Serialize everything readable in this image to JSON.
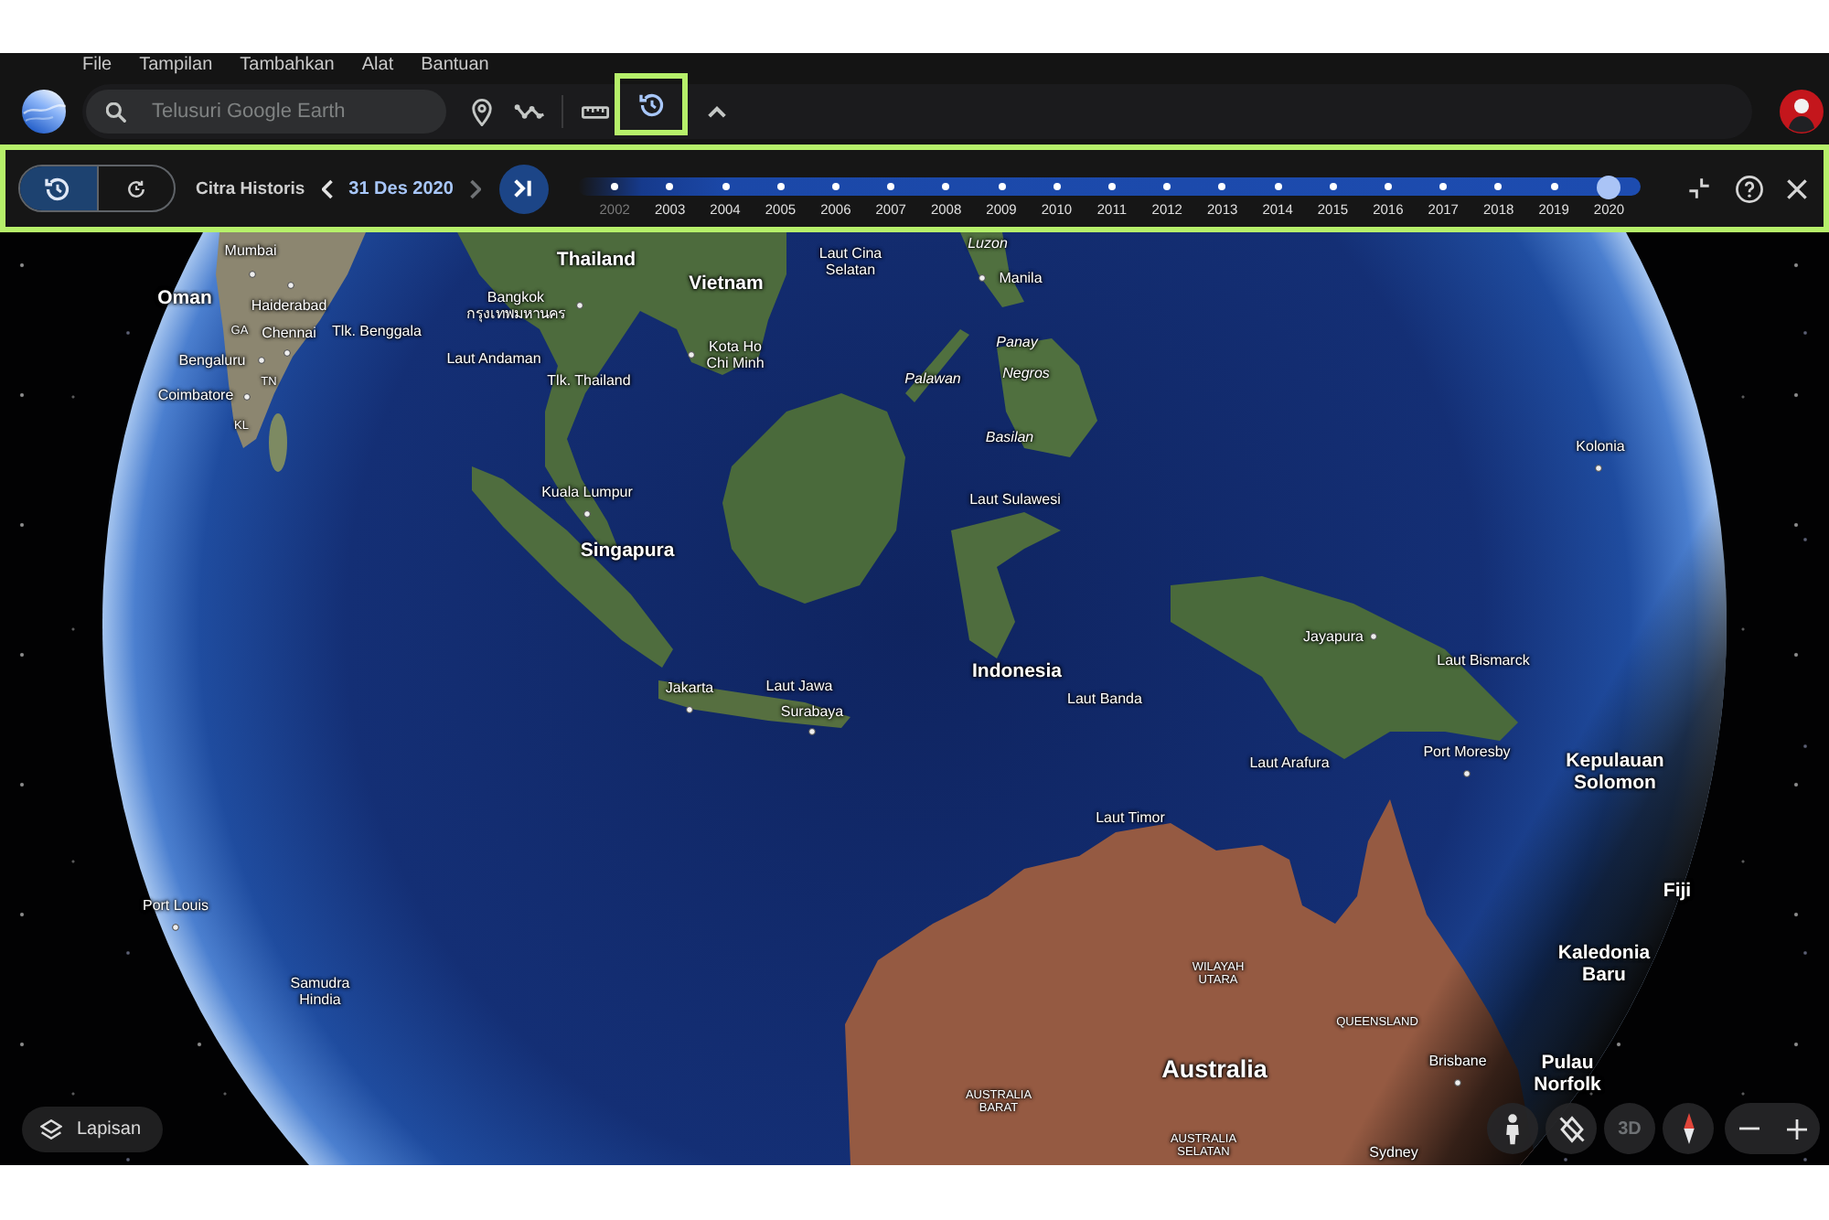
{
  "menu_bar": {
    "items": [
      "File",
      "Tampilan",
      "Tambahkan",
      "Alat",
      "Bantuan"
    ]
  },
  "toolbar": {
    "search": {
      "placeholder": "Telusuri Google Earth"
    },
    "tools": [
      {
        "kind": "placemark",
        "highlighted": false
      },
      {
        "kind": "path",
        "highlighted": false
      },
      {
        "kind": "divider"
      },
      {
        "kind": "ruler",
        "highlighted": false
      },
      {
        "kind": "history",
        "highlighted": true
      },
      {
        "kind": "toggle_toolbar",
        "highlighted": false
      }
    ]
  },
  "history_bar": {
    "highlighted": true,
    "modes": [
      {
        "kind": "history",
        "selected": true
      },
      {
        "kind": "timelapse",
        "selected": false
      }
    ],
    "title": "Citra Historis",
    "previous": {
      "disabled": false
    },
    "date": "31 Des 2020",
    "next": {
      "disabled": true
    },
    "years": [
      {
        "label": "2002",
        "selected": false,
        "dimmed": true
      },
      {
        "label": "2003",
        "selected": false,
        "dimmed": false
      },
      {
        "label": "2004",
        "selected": false,
        "dimmed": false
      },
      {
        "label": "2005",
        "selected": false,
        "dimmed": false
      },
      {
        "label": "2006",
        "selected": false,
        "dimmed": false
      },
      {
        "label": "2007",
        "selected": false,
        "dimmed": false
      },
      {
        "label": "2008",
        "selected": false,
        "dimmed": false
      },
      {
        "label": "2009",
        "selected": false,
        "dimmed": false
      },
      {
        "label": "2010",
        "selected": false,
        "dimmed": false
      },
      {
        "label": "2011",
        "selected": false,
        "dimmed": false
      },
      {
        "label": "2012",
        "selected": false,
        "dimmed": false
      },
      {
        "label": "2013",
        "selected": false,
        "dimmed": false
      },
      {
        "label": "2014",
        "selected": false,
        "dimmed": false
      },
      {
        "label": "2015",
        "selected": false,
        "dimmed": false
      },
      {
        "label": "2016",
        "selected": false,
        "dimmed": false
      },
      {
        "label": "2017",
        "selected": false,
        "dimmed": false
      },
      {
        "label": "2018",
        "selected": false,
        "dimmed": false
      },
      {
        "label": "2019",
        "selected": false,
        "dimmed": false
      },
      {
        "label": "2020",
        "selected": true,
        "dimmed": false
      }
    ],
    "actions": [
      {
        "kind": "collapse"
      },
      {
        "kind": "help"
      },
      {
        "kind": "close"
      }
    ]
  },
  "map": {
    "labels": [
      {
        "text": "Mumbai",
        "kind": "place"
      },
      {
        "text": "Oman",
        "kind": "country"
      },
      {
        "text": "Haiderabad",
        "kind": "place"
      },
      {
        "text": "GA",
        "kind": "region"
      },
      {
        "text": "Chennai",
        "kind": "place"
      },
      {
        "text": "Tlk. Benggala",
        "kind": "place"
      },
      {
        "text": "Bengaluru",
        "kind": "place"
      },
      {
        "text": "TN",
        "kind": "region"
      },
      {
        "text": "Coimbatore",
        "kind": "place"
      },
      {
        "text": "KL",
        "kind": "region"
      },
      {
        "text": "Thailand",
        "kind": "country"
      },
      {
        "text": "Vietnam",
        "kind": "country"
      },
      {
        "text": "Laut Cina\nSelatan",
        "kind": "place"
      },
      {
        "text": "Bangkok\nกรุงเทพมหานคร",
        "kind": "place"
      },
      {
        "text": "Laut Andaman",
        "kind": "place"
      },
      {
        "text": "Kota Ho\nChi Minh",
        "kind": "place"
      },
      {
        "text": "Tlk. Thailand",
        "kind": "place"
      },
      {
        "text": "Kuala Lumpur",
        "kind": "place"
      },
      {
        "text": "Singapura",
        "kind": "country"
      },
      {
        "text": "Jakarta",
        "kind": "place"
      },
      {
        "text": "Laut Jawa",
        "kind": "place"
      },
      {
        "text": "Surabaya",
        "kind": "place"
      },
      {
        "text": "Luzon",
        "kind": "island"
      },
      {
        "text": "Manila",
        "kind": "place"
      },
      {
        "text": "Panay",
        "kind": "island"
      },
      {
        "text": "Palawan",
        "kind": "island"
      },
      {
        "text": "Negros",
        "kind": "island"
      },
      {
        "text": "Basilan",
        "kind": "island"
      },
      {
        "text": "Laut Sulawesi",
        "kind": "place"
      },
      {
        "text": "Kolonia",
        "kind": "place"
      },
      {
        "text": "Jayapura",
        "kind": "place"
      },
      {
        "text": "Indonesia",
        "kind": "country"
      },
      {
        "text": "Laut Bismarck",
        "kind": "place"
      },
      {
        "text": "Laut Banda",
        "kind": "place"
      },
      {
        "text": "Laut Arafura",
        "kind": "place"
      },
      {
        "text": "Port Moresby",
        "kind": "place"
      },
      {
        "text": "Kepulauan\nSolomon",
        "kind": "country"
      },
      {
        "text": "Laut Timor",
        "kind": "place"
      },
      {
        "text": "Port Louis",
        "kind": "place"
      },
      {
        "text": "Fiji",
        "kind": "country"
      },
      {
        "text": "Samudra\nHindia",
        "kind": "place"
      },
      {
        "text": "WILAYAH\nUTARA",
        "kind": "region"
      },
      {
        "text": "Kaledonia\nBaru",
        "kind": "country"
      },
      {
        "text": "QUEENSLAND",
        "kind": "region"
      },
      {
        "text": "Australia",
        "kind": "continent"
      },
      {
        "text": "Brisbane",
        "kind": "place"
      },
      {
        "text": "AUSTRALIA\nBARAT",
        "kind": "region"
      },
      {
        "text": "Pulau\nNorfolk",
        "kind": "country"
      },
      {
        "text": "AUSTRALIA\nSELATAN",
        "kind": "region"
      },
      {
        "text": "Sydney",
        "kind": "place"
      }
    ]
  },
  "map_controls": {
    "layers": {
      "label": "Lapisan"
    },
    "buttons": [
      {
        "kind": "street_view"
      },
      {
        "kind": "tilt"
      },
      {
        "kind": "view_3d",
        "label": "3D",
        "on": false
      },
      {
        "kind": "compass"
      }
    ],
    "zoom": [
      {
        "kind": "zoom_out"
      },
      {
        "kind": "zoom_in"
      }
    ]
  }
}
